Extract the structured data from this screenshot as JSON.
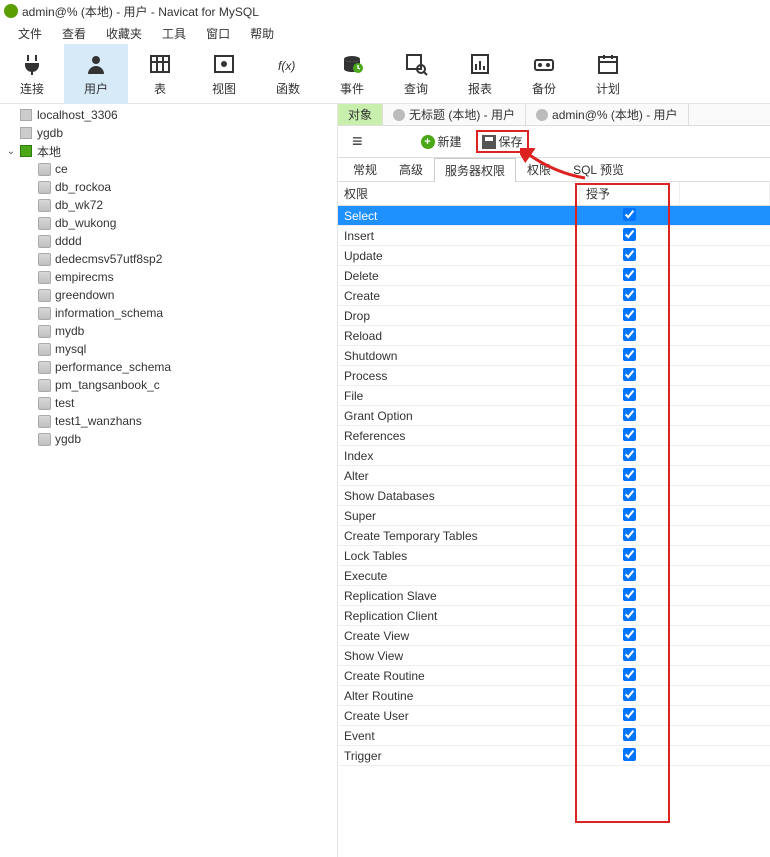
{
  "title": "admin@% (本地) - 用户 - Navicat for MySQL",
  "menu": [
    "文件",
    "查看",
    "收藏夹",
    "工具",
    "窗口",
    "帮助"
  ],
  "toolbar": [
    {
      "label": "连接",
      "icon": "plug"
    },
    {
      "label": "用户",
      "icon": "user",
      "active": true
    },
    {
      "label": "表",
      "icon": "table"
    },
    {
      "label": "视图",
      "icon": "view"
    },
    {
      "label": "函数",
      "icon": "fx"
    },
    {
      "label": "事件",
      "icon": "event"
    },
    {
      "label": "查询",
      "icon": "query"
    },
    {
      "label": "报表",
      "icon": "report"
    },
    {
      "label": "备份",
      "icon": "backup"
    },
    {
      "label": "计划",
      "icon": "schedule"
    }
  ],
  "connections": [
    {
      "name": "localhost_3306",
      "expanded": false,
      "active": false
    },
    {
      "name": "ygdb",
      "expanded": false,
      "active": false
    },
    {
      "name": "本地",
      "expanded": true,
      "active": true,
      "dbs": [
        "ce",
        "db_rockoa",
        "db_wk72",
        "db_wukong",
        "dddd",
        "dedecmsv57utf8sp2",
        "empirecms",
        "greendown",
        "information_schema",
        "mydb",
        "mysql",
        "performance_schema",
        "pm_tangsanbook_c",
        "test",
        "test1_wanzhans",
        "ygdb"
      ]
    }
  ],
  "tabs": [
    {
      "label": "对象",
      "active": true
    },
    {
      "label": "无标题 (本地) - 用户",
      "icon": true
    },
    {
      "label": "admin@% (本地) - 用户",
      "icon": true
    }
  ],
  "actions": {
    "new": "新建",
    "save": "保存"
  },
  "subtabs": [
    {
      "label": "常规"
    },
    {
      "label": "高级"
    },
    {
      "label": "服务器权限",
      "active": true
    },
    {
      "label": "权限"
    },
    {
      "label": "SQL 预览"
    }
  ],
  "perm_header": {
    "name": "权限",
    "grant": "授予"
  },
  "permissions": [
    {
      "name": "Select",
      "granted": true,
      "selected": true
    },
    {
      "name": "Insert",
      "granted": true
    },
    {
      "name": "Update",
      "granted": true
    },
    {
      "name": "Delete",
      "granted": true
    },
    {
      "name": "Create",
      "granted": true
    },
    {
      "name": "Drop",
      "granted": true
    },
    {
      "name": "Reload",
      "granted": true
    },
    {
      "name": "Shutdown",
      "granted": true
    },
    {
      "name": "Process",
      "granted": true
    },
    {
      "name": "File",
      "granted": true
    },
    {
      "name": "Grant Option",
      "granted": true
    },
    {
      "name": "References",
      "granted": true
    },
    {
      "name": "Index",
      "granted": true
    },
    {
      "name": "Alter",
      "granted": true
    },
    {
      "name": "Show Databases",
      "granted": true
    },
    {
      "name": "Super",
      "granted": true
    },
    {
      "name": "Create Temporary Tables",
      "granted": true
    },
    {
      "name": "Lock Tables",
      "granted": true
    },
    {
      "name": "Execute",
      "granted": true
    },
    {
      "name": "Replication Slave",
      "granted": true
    },
    {
      "name": "Replication Client",
      "granted": true
    },
    {
      "name": "Create View",
      "granted": true
    },
    {
      "name": "Show View",
      "granted": true
    },
    {
      "name": "Create Routine",
      "granted": true
    },
    {
      "name": "Alter Routine",
      "granted": true
    },
    {
      "name": "Create User",
      "granted": true
    },
    {
      "name": "Event",
      "granted": true
    },
    {
      "name": "Trigger",
      "granted": true
    }
  ]
}
